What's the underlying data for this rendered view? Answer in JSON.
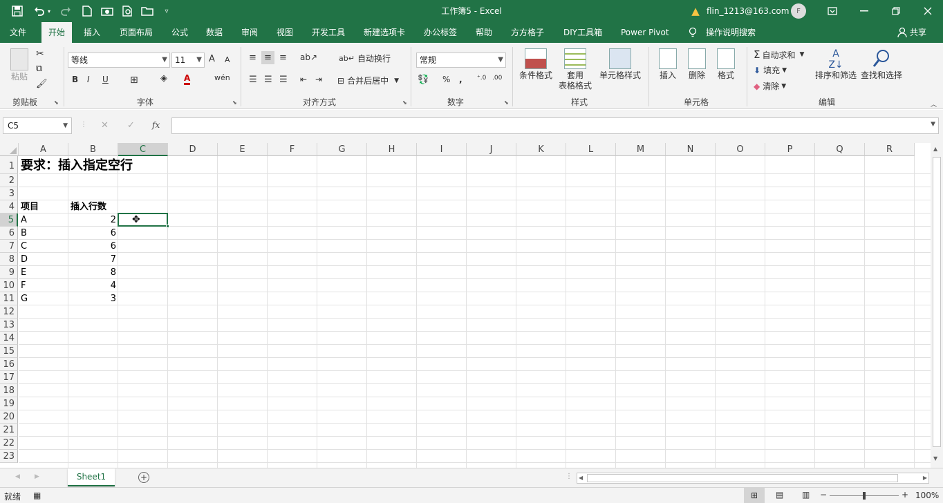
{
  "window": {
    "title": "工作簿5  -  Excel",
    "user": "flin_1213@163.com",
    "avatar_letter": "F",
    "accent": "#217346"
  },
  "menu": {
    "file": "文件",
    "home": "开始",
    "insert": "插入",
    "page_layout": "页面布局",
    "formulas": "公式",
    "data": "数据",
    "review": "审阅",
    "view": "视图",
    "developer": "开发工具",
    "new_tab": "新建选项卡",
    "office_tab": "办公标签",
    "help": "帮助",
    "ffgz": "方方格子",
    "diy": "DIY工具箱",
    "power_pivot": "Power Pivot",
    "tell_me": "操作说明搜索",
    "share": "共享"
  },
  "ribbon": {
    "clipboard": {
      "paste": "粘贴",
      "label": "剪贴板"
    },
    "font": {
      "name": "等线",
      "size": "11",
      "bold": "B",
      "italic": "I",
      "underline": "U",
      "grow": "A",
      "shrink": "A",
      "label": "字体"
    },
    "alignment": {
      "wrap": "自动换行",
      "merge": "合并后居中",
      "label": "对齐方式"
    },
    "number": {
      "format": "常规",
      "percent": "%",
      "comma": ",",
      "label": "数字"
    },
    "styles": {
      "conditional": "条件格式",
      "table_l1": "套用",
      "table_l2": "表格格式",
      "cell_styles": "单元格样式",
      "label": "样式"
    },
    "cells": {
      "insert": "插入",
      "delete": "删除",
      "format": "格式",
      "label": "单元格"
    },
    "editing": {
      "autosum": "自动求和",
      "fill": "填充",
      "clear": "清除",
      "sort": "排序和筛选",
      "find": "查找和选择",
      "label": "编辑"
    }
  },
  "formula_bar": {
    "name_box": "C5",
    "fx": "fx",
    "content": ""
  },
  "sheet": {
    "columns": [
      "A",
      "B",
      "C",
      "D",
      "E",
      "F",
      "G",
      "H",
      "I",
      "J",
      "K",
      "L",
      "M",
      "N",
      "O",
      "P",
      "Q",
      "R"
    ],
    "rows": [
      "1",
      "2",
      "3",
      "4",
      "5",
      "6",
      "7",
      "8",
      "9",
      "10",
      "11",
      "12",
      "13",
      "14",
      "15",
      "16",
      "17",
      "18",
      "19",
      "20",
      "21",
      "22",
      "23"
    ],
    "selected_cell": "C5",
    "title": "要求：插入指定空行",
    "header_item": "项目",
    "header_count": "插入行数",
    "items": [
      {
        "name": "A",
        "count": "2"
      },
      {
        "name": "B",
        "count": "6"
      },
      {
        "name": "C",
        "count": "6"
      },
      {
        "name": "D",
        "count": "7"
      },
      {
        "name": "E",
        "count": "8"
      },
      {
        "name": "F",
        "count": "4"
      },
      {
        "name": "G",
        "count": "3"
      }
    ]
  },
  "tabs": {
    "sheet1": "Sheet1"
  },
  "status": {
    "ready": "就绪",
    "zoom": "100%"
  }
}
